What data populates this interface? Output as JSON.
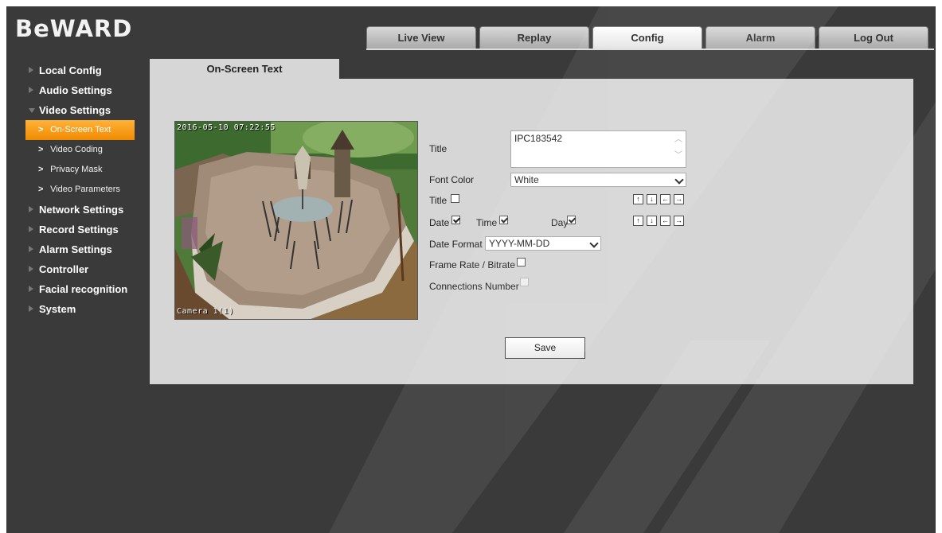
{
  "app": {
    "logo_text": "BeWARD"
  },
  "tabs": [
    {
      "label": "Live View",
      "active": false
    },
    {
      "label": "Replay",
      "active": false
    },
    {
      "label": "Config",
      "active": true
    },
    {
      "label": "Alarm",
      "active": false
    },
    {
      "label": "Log Out",
      "active": false
    }
  ],
  "sidebar": {
    "items": [
      {
        "label": "Local Config"
      },
      {
        "label": "Audio Settings"
      },
      {
        "label": "Video Settings",
        "expanded": true
      },
      {
        "label": "On-Screen Text",
        "sub": true,
        "active": true
      },
      {
        "label": "Video Coding",
        "sub": true
      },
      {
        "label": "Privacy Mask",
        "sub": true
      },
      {
        "label": "Video Parameters",
        "sub": true
      },
      {
        "label": "Network Settings"
      },
      {
        "label": "Record Settings"
      },
      {
        "label": "Alarm Settings"
      },
      {
        "label": "Controller"
      },
      {
        "label": "Facial recognition"
      },
      {
        "label": "System"
      }
    ]
  },
  "content": {
    "tab_label": "On-Screen Text",
    "preview": {
      "osd_datetime": "2016-05-10 07:22:55",
      "osd_camera": "Camera 1(1)"
    },
    "form": {
      "title_label": "Title",
      "title_value": "IPC183542",
      "font_color_label": "Font Color",
      "font_color_value": "White",
      "title_check_label": "Title",
      "title_checked": false,
      "date_label": "Date",
      "date_checked": true,
      "time_label": "Time",
      "time_checked": true,
      "day_label": "Day",
      "day_checked": true,
      "date_format_label": "Date Format",
      "date_format_value": "YYYY-MM-DD",
      "frame_rate_label": "Frame Rate / Bitrate",
      "frame_rate_checked": false,
      "connections_label": "Connections Number",
      "connections_checked": false,
      "connections_disabled": true,
      "save_label": "Save"
    },
    "arrow_buttons": [
      "↑",
      "↓",
      "←",
      "→"
    ]
  },
  "colors": {
    "background": "#3a3a3a",
    "panel": "#d6d6d6",
    "active_menu": "#f39a12",
    "tab_active": "#ffffff"
  }
}
